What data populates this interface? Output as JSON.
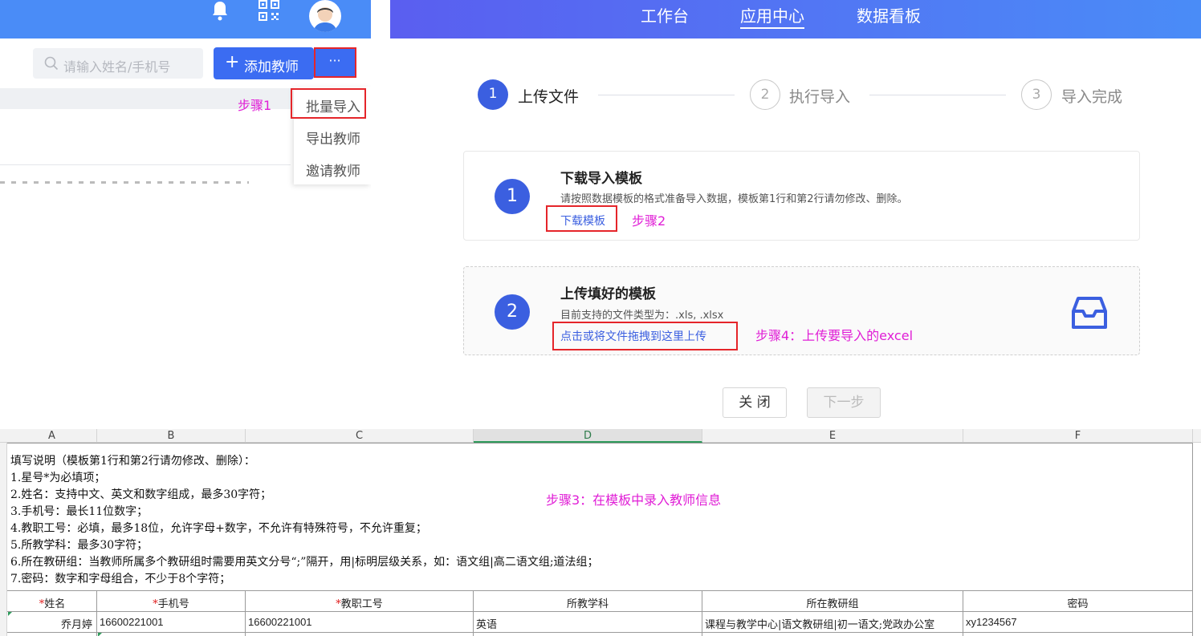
{
  "left_panel": {
    "search_placeholder": "请输入姓名/手机号",
    "add_button": "添加教师",
    "more_button": "···",
    "dropdown": [
      "批量导入",
      "导出教师",
      "邀请教师"
    ]
  },
  "top_nav": {
    "items": [
      "工作台",
      "应用中心",
      "数据看板"
    ],
    "active": "应用中心"
  },
  "steps": [
    {
      "num": "1",
      "label": "上传文件",
      "active": true
    },
    {
      "num": "2",
      "label": "执行导入",
      "active": false
    },
    {
      "num": "3",
      "label": "导入完成",
      "active": false
    }
  ],
  "card1": {
    "num": "1",
    "title": "下载导入模板",
    "desc": "请按照数据模板的格式准备导入数据，模板第1行和第2行请勿修改、删除。",
    "link": "下载模板"
  },
  "card2": {
    "num": "2",
    "title": "上传填好的模板",
    "desc": "目前支持的文件类型为：.xls, .xlsx",
    "link": "点击或将文件拖拽到这里上传"
  },
  "buttons": {
    "close": "关 闭",
    "next": "下一步"
  },
  "annotations": {
    "step1": "步骤1",
    "step2": "步骤2",
    "step3": "步骤3：在模板中录入教师信息",
    "step4": "步骤4：上传要导入的excel"
  },
  "sheet": {
    "columns": [
      "A",
      "B",
      "C",
      "D",
      "E",
      "F"
    ],
    "selected_column": "D",
    "instructions": [
      "填写说明（模板第1行和第2行请勿修改、删除）：",
      "1.星号*为必填项；",
      "2.姓名：支持中文、英文和数字组成，最多30字符；",
      "3.手机号：最长11位数字；",
      "4.教职工号：必填，最多18位，允许字母+数字，不允许有特殊符号，不允许重复；",
      "5.所教学科：最多30字符；",
      "6.所在教研组：当教师所属多个教研组时需要用英文分号“;”隔开，用|标明层级关系，如：语文组|高二语文组;道法组；",
      "7.密码：数字和字母组合，不少于8个字符；"
    ],
    "headers": [
      "姓名",
      "手机号",
      "教职工号",
      "所教学科",
      "所在教研组",
      "密码"
    ],
    "required": [
      "*",
      "*",
      "*",
      "",
      "",
      ""
    ],
    "row": [
      "乔月婷",
      "16600221001",
      "16600221001",
      "英语",
      "课程与教学中心|语文教研组|初一语文;党政办公室",
      "xy1234567"
    ]
  },
  "colors": {
    "primary": "#3b5fe0",
    "annotation": "#e01ed6",
    "highlight_box": "#e5252a"
  }
}
